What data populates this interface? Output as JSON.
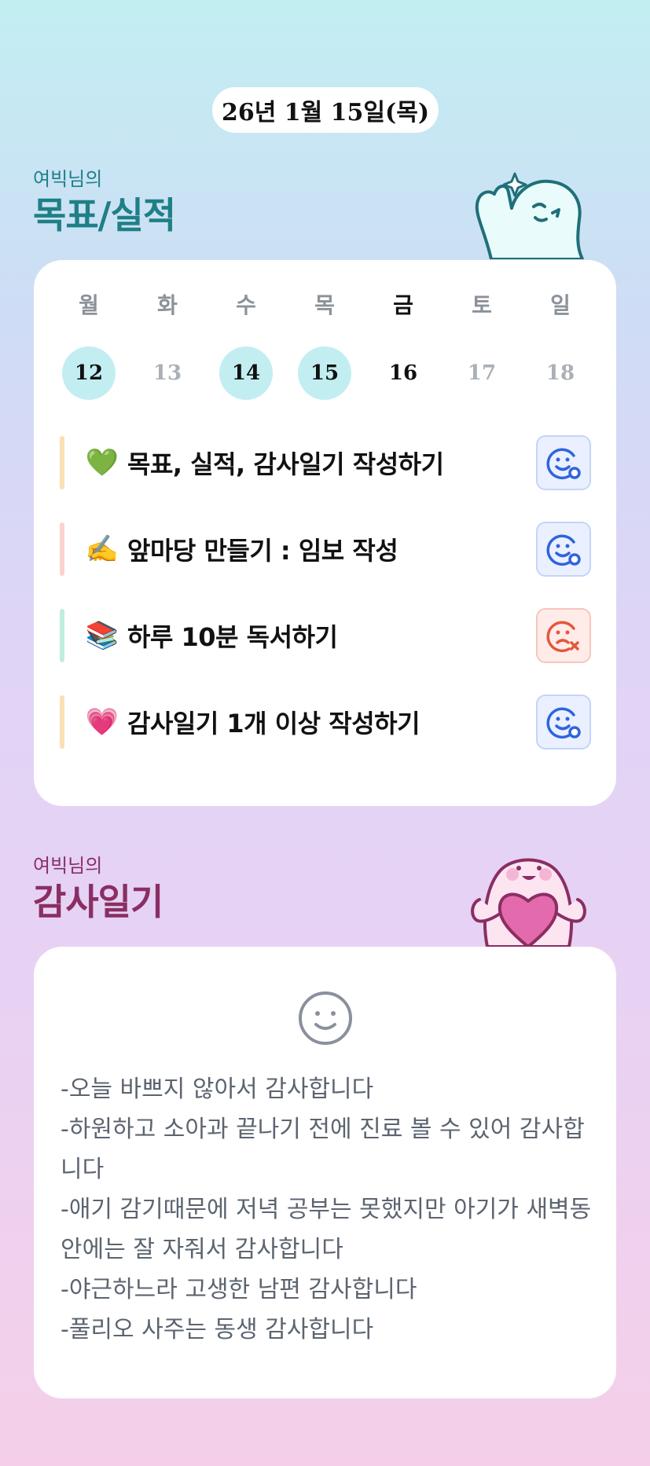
{
  "date": "26년 1월 15일(목)",
  "goals_section": {
    "subtitle": "여빅님의",
    "title": "목표/실적"
  },
  "week": {
    "weekdays": [
      "월",
      "화",
      "수",
      "목",
      "금",
      "토",
      "일"
    ],
    "days": [
      {
        "num": "12",
        "state": "done"
      },
      {
        "num": "13",
        "state": "none"
      },
      {
        "num": "14",
        "state": "done"
      },
      {
        "num": "15",
        "state": "done"
      },
      {
        "num": "16",
        "state": "today"
      },
      {
        "num": "17",
        "state": "none"
      },
      {
        "num": "18",
        "state": "none"
      }
    ]
  },
  "goals": [
    {
      "emoji": "💚",
      "text": "목표, 실적, 감사일기 작성하기",
      "bar_color": "#f9e0b4",
      "status": "achieved",
      "status_icon": "smile-check-icon"
    },
    {
      "emoji": "✍️",
      "text": "앞마당 만들기 : 임보 작성",
      "bar_color": "#f9d4cf",
      "status": "achieved",
      "status_icon": "smile-check-icon"
    },
    {
      "emoji": "📚",
      "text": "하루 10분 독서하기",
      "bar_color": "#bfeedd",
      "status": "failed",
      "status_icon": "sad-x-icon"
    },
    {
      "emoji": "💗",
      "text": "감사일기 1개 이상 작성하기",
      "bar_color": "#f9e0b4",
      "status": "achieved",
      "status_icon": "smile-check-icon"
    }
  ],
  "diary_section": {
    "subtitle": "여빅님의",
    "title": "감사일기"
  },
  "diary": {
    "mood_icon": "smile-face-icon",
    "lines": [
      "-오늘 바쁘지 않아서 감사합니다",
      "-하원하고 소아과 끝나기 전에 진료 볼 수 있어 감사합니다",
      "-애기 감기때문에 저녁 공부는 못했지만 아기가 새벽동안에는 잘 자줘서 감사합니다",
      "-야근하느라 고생한 남편 감사합니다",
      "-풀리오 사주는 동생 감사합니다"
    ]
  },
  "colors": {
    "accent_teal": "#1f7f86",
    "accent_plum": "#8a2e63",
    "done_circle": "#c2eef2",
    "ok_blue": "#2f63e0",
    "fail_red": "#e4573d"
  }
}
